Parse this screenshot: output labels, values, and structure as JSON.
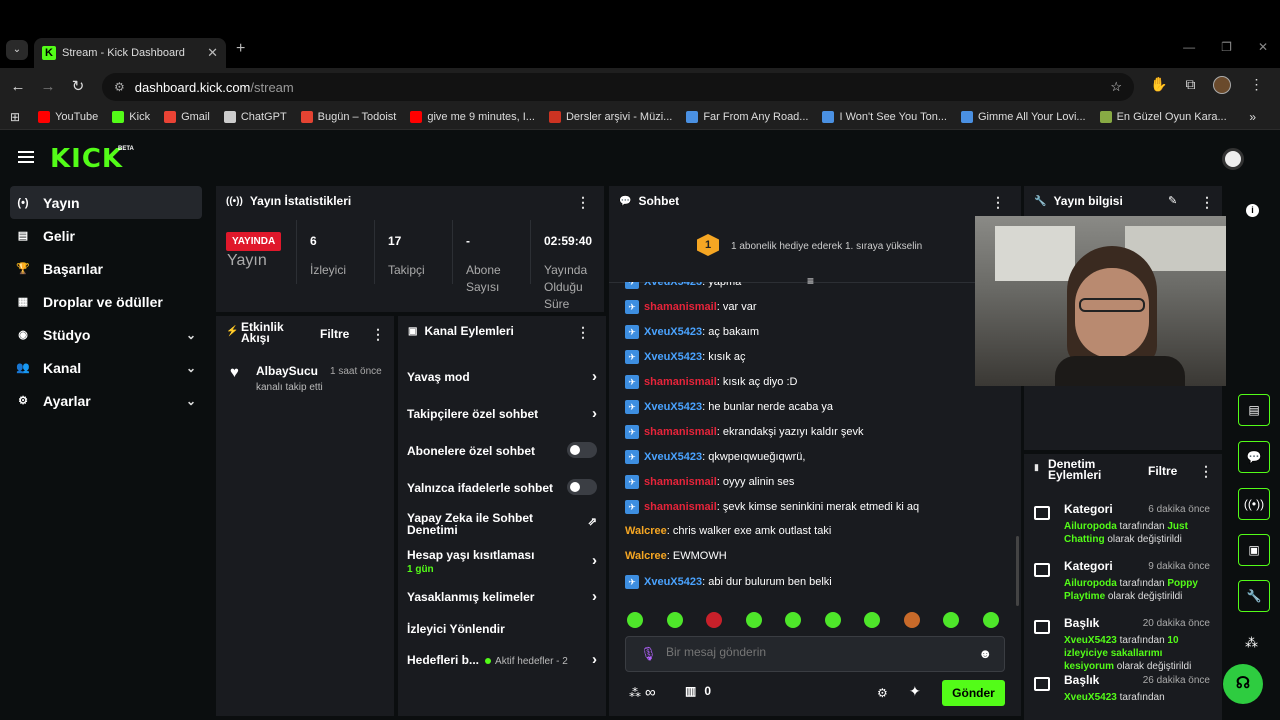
{
  "browser": {
    "tab_title": "Stream - Kick Dashboard",
    "tab_favicon": "K",
    "url_domain": "dashboard.kick.com",
    "url_path": "/stream",
    "bookmarks": [
      {
        "label": "YouTube",
        "color": "#ff0000"
      },
      {
        "label": "Kick",
        "color": "#53fc18"
      },
      {
        "label": "Gmail",
        "color": "#ea4335"
      },
      {
        "label": "ChatGPT",
        "color": "#cccccc"
      },
      {
        "label": "Bugün – Todoist",
        "color": "#e44332"
      },
      {
        "label": "give me 9 minutes, I...",
        "color": "#ff0000"
      },
      {
        "label": "Dersler arşivi - Müzi...",
        "color": "#cc3322"
      },
      {
        "label": "Far From Any Road...",
        "color": "#4a90e2"
      },
      {
        "label": "I Won't See You Ton...",
        "color": "#4a90e2"
      },
      {
        "label": "Gimme All Your Lovi...",
        "color": "#4a90e2"
      },
      {
        "label": "En Güzel Oyun Kara...",
        "color": "#88aa44"
      }
    ]
  },
  "app": {
    "logo": "KICK",
    "beta": "BETA",
    "accent": "#53fc18"
  },
  "sidebar": {
    "items": [
      {
        "label": "Yayın",
        "icon": "broadcast-icon",
        "glyph": "(•)",
        "active": true,
        "chevron": false
      },
      {
        "label": "Gelir",
        "icon": "revenue-icon",
        "glyph": "▤",
        "active": false,
        "chevron": false
      },
      {
        "label": "Başarılar",
        "icon": "trophy-icon",
        "glyph": "🏆",
        "active": false,
        "chevron": false
      },
      {
        "label": "Droplar ve ödüller",
        "icon": "gift-icon",
        "glyph": "▦",
        "active": false,
        "chevron": false
      },
      {
        "label": "Stüdyo",
        "icon": "studio-icon",
        "glyph": "◉",
        "active": false,
        "chevron": true
      },
      {
        "label": "Kanal",
        "icon": "channel-icon",
        "glyph": "👥",
        "active": false,
        "chevron": true
      },
      {
        "label": "Ayarlar",
        "icon": "settings-icon",
        "glyph": "⚙",
        "active": false,
        "chevron": true
      }
    ]
  },
  "stats": {
    "title": "Yayın İstatistikleri",
    "live_badge": "YAYINDA",
    "live_label": "Yayın",
    "viewers_value": "6",
    "viewers_label": "İzleyici",
    "followers_value": "17",
    "followers_label": "Takipçi",
    "subs_value": "-",
    "subs_label": "Abone Sayısı",
    "duration_value": "02:59:40",
    "duration_label": "Yayında Olduğu Süre"
  },
  "activity": {
    "title": "Etkinlik Akışı",
    "filter": "Filtre",
    "items": [
      {
        "user": "AlbaySucu",
        "time": "1 saat önce",
        "text": "kanalı takip etti"
      }
    ]
  },
  "channel_actions": {
    "title": "Kanal Eylemleri",
    "slow_mode": "Yavaş mod",
    "followers_only": "Takipçilere özel sohbet",
    "subs_only": "Abonelere özel sohbet",
    "emote_only": "Yalnızca ifadelerle sohbet",
    "ai_moderation": "Yapay Zeka ile Sohbet Denetimi",
    "account_age": "Hesap yaşı kısıtlaması",
    "account_age_value": "1 gün",
    "banned_words": "Yasaklanmış kelimeler",
    "redirect": "İzleyici Yönlendir",
    "goals": "Hedefleri b...",
    "goals_status": "Aktif hedefler - 2"
  },
  "chat": {
    "title": "Sohbet",
    "gift_rank": "1",
    "gift_text": "1 abonelik hediye ederek 1. sıraya yükselin",
    "messages": [
      {
        "user": "XveuX5423",
        "color": "blue",
        "text": "yapma",
        "badge": true
      },
      {
        "user": "shamanismail",
        "color": "red",
        "text": "var var",
        "badge": true
      },
      {
        "user": "XveuX5423",
        "color": "blue",
        "text": "aç bakaım",
        "badge": true
      },
      {
        "user": "XveuX5423",
        "color": "blue",
        "text": "kısık aç",
        "badge": true
      },
      {
        "user": "shamanismail",
        "color": "red",
        "text": "kısık aç diyo :D",
        "badge": true
      },
      {
        "user": "XveuX5423",
        "color": "blue",
        "text": "he bunlar nerde acaba ya",
        "badge": true
      },
      {
        "user": "shamanismail",
        "color": "red",
        "text": "ekrandakşi yazıyı kaldır şevk",
        "badge": true
      },
      {
        "user": "XveuX5423",
        "color": "blue",
        "text": "qkwpeıqwueğıqwrü,",
        "badge": true
      },
      {
        "user": "shamanismail",
        "color": "red",
        "text": "oyyy alinin ses",
        "badge": true
      },
      {
        "user": "shamanismail",
        "color": "red",
        "text": "şevk kimse seninkini merak etmedi ki aq",
        "badge": true
      },
      {
        "user": "Walcree",
        "color": "orange",
        "text": "chris walker exe amk outlast taki",
        "badge": false
      },
      {
        "user": "Walcree",
        "color": "orange",
        "text": "EWMOWH",
        "badge": false
      },
      {
        "user": "XveuX5423",
        "color": "blue",
        "text": "abi dur bulurum ben belki",
        "badge": true
      }
    ],
    "input_placeholder": "Bir mesaj gönderin",
    "points": "∞",
    "store_count": "0",
    "send_button": "Gönder"
  },
  "stream_info": {
    "title": "Yayın bilgisi"
  },
  "moderation": {
    "title": "Denetim Eylemleri",
    "filter": "Filtre",
    "items": [
      {
        "title": "Kategori",
        "time": "6 dakika önce",
        "user": "Ailuropoda",
        "mid": " tarafından ",
        "value": "Just Chatting",
        "end": " olarak değiştirildi"
      },
      {
        "title": "Kategori",
        "time": "9 dakika önce",
        "user": "Ailuropoda",
        "mid": " tarafından ",
        "value": "Poppy Playtime",
        "end": " olarak değiştirildi"
      },
      {
        "title": "Başlık",
        "time": "20 dakika önce",
        "user": "XveuX5423",
        "mid": " tarafından ",
        "value": "10 izleyiciye sakallarımı kesiyorum",
        "end": " olarak değiştirildi"
      },
      {
        "title": "Başlık",
        "time": "26 dakika önce",
        "user": "XveuX5423",
        "mid": " tarafından",
        "value": "",
        "end": ""
      }
    ]
  }
}
